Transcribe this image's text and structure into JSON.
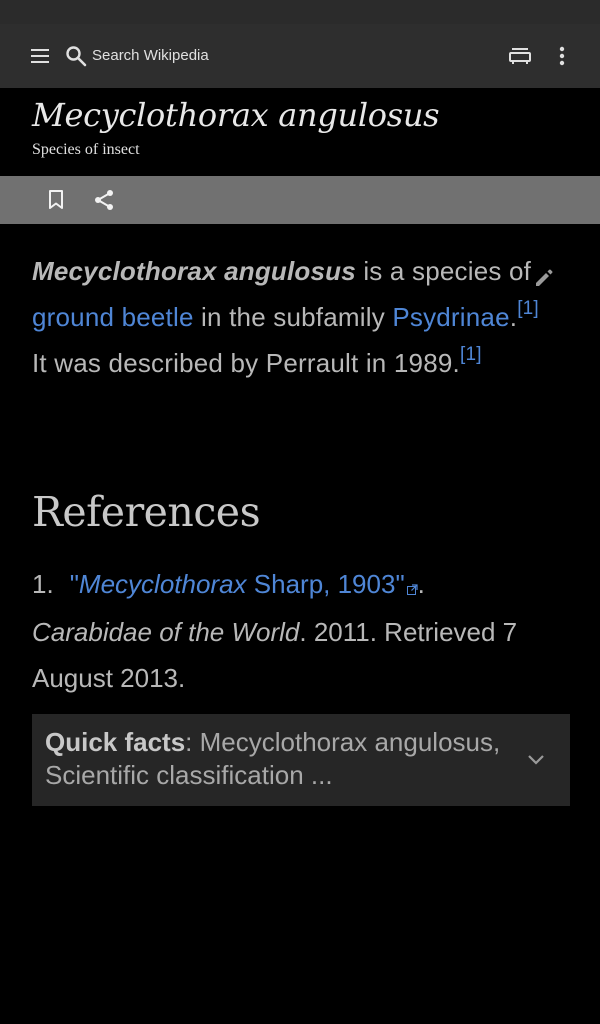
{
  "toolbar": {
    "search_placeholder": "Search Wikipedia"
  },
  "article": {
    "title": "Mecyclothorax angulosus",
    "subtitle": "Species of insect",
    "lead": {
      "bold_name": "Mecyclothorax angulosus",
      "text1": " is a species of ",
      "link_ground_beetle": "ground beetle",
      "text2": " in the subfamily ",
      "link_psydrinae": "Psydrinae",
      "period": ".",
      "cite1": "[1]",
      "text3": " It was described by Perrault in 1989.",
      "cite2": "[1]"
    }
  },
  "references": {
    "heading": "References",
    "items": [
      {
        "number": "1.",
        "link_prefix": "\"",
        "link_italic": "Mecyclothorax",
        "link_rest": " Sharp, 1903\"",
        "period": ".",
        "source_italic": "Carabidae of the World",
        "source_rest": ". 2011. Retrieved 7 August 2013."
      }
    ]
  },
  "quickfacts": {
    "label": "Quick facts",
    "text": ": Mecyclothorax angulosus, Scientific classification ..."
  },
  "colors": {
    "link": "#4f86d6",
    "toolbar_bg": "#2e2e2e",
    "actionbar_bg": "#717171",
    "page_bg": "#000000"
  },
  "icons": {
    "menu": "menu-icon",
    "search": "search-icon",
    "tabs": "tabs-icon",
    "overflow": "more-vert-icon",
    "bookmark": "bookmark-icon",
    "share": "share-icon",
    "edit": "edit-pencil-icon",
    "external": "external-link-icon",
    "chevron": "chevron-down-icon"
  }
}
